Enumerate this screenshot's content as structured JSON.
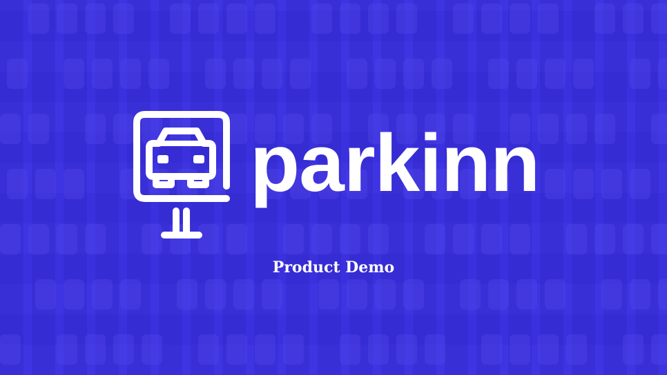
{
  "slide": {
    "brand_name": "parkinn",
    "subtitle": "Product Demo",
    "logo_icon": "parking-sign-car-icon",
    "background": "aerial-parking-lot-photo",
    "colors": {
      "overlay": "#3b30de",
      "text": "#ffffff"
    }
  }
}
